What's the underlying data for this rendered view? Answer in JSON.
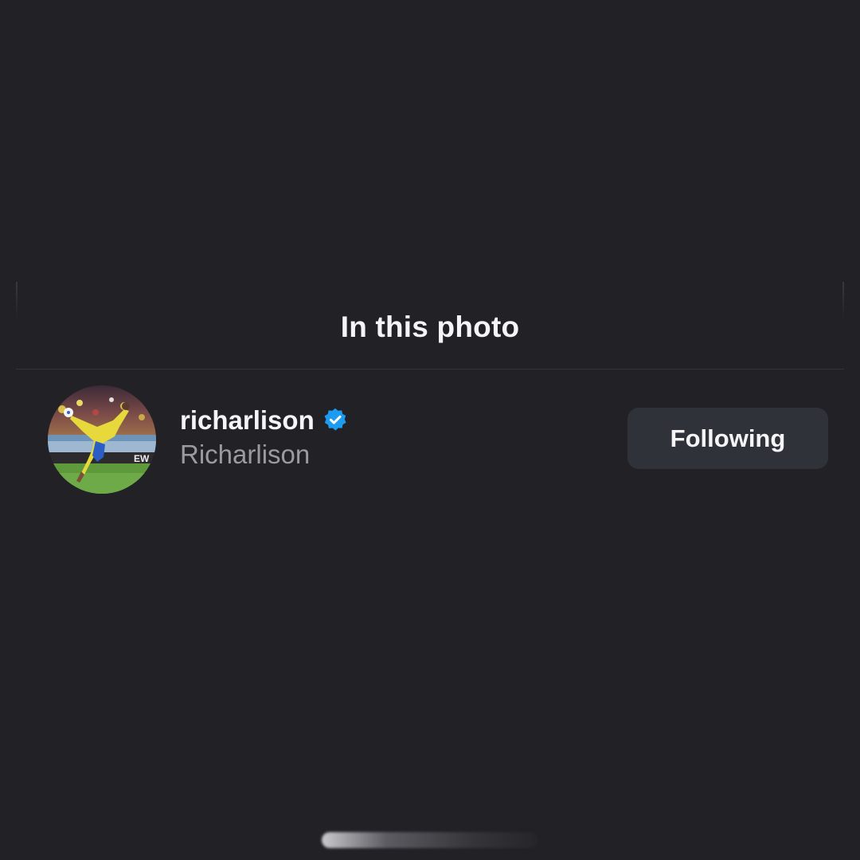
{
  "sheet": {
    "title": "In this photo"
  },
  "tagged_people": [
    {
      "username": "richarlison",
      "full_name": "Richarlison",
      "verified": true,
      "follow_button_label": "Following"
    }
  ],
  "colors": {
    "background": "#212126",
    "button_background": "#30323a",
    "verified_badge": "#1d9bf0",
    "secondary_text": "#9a9ba1"
  },
  "icons": {
    "verified": "verified-badge-icon"
  }
}
